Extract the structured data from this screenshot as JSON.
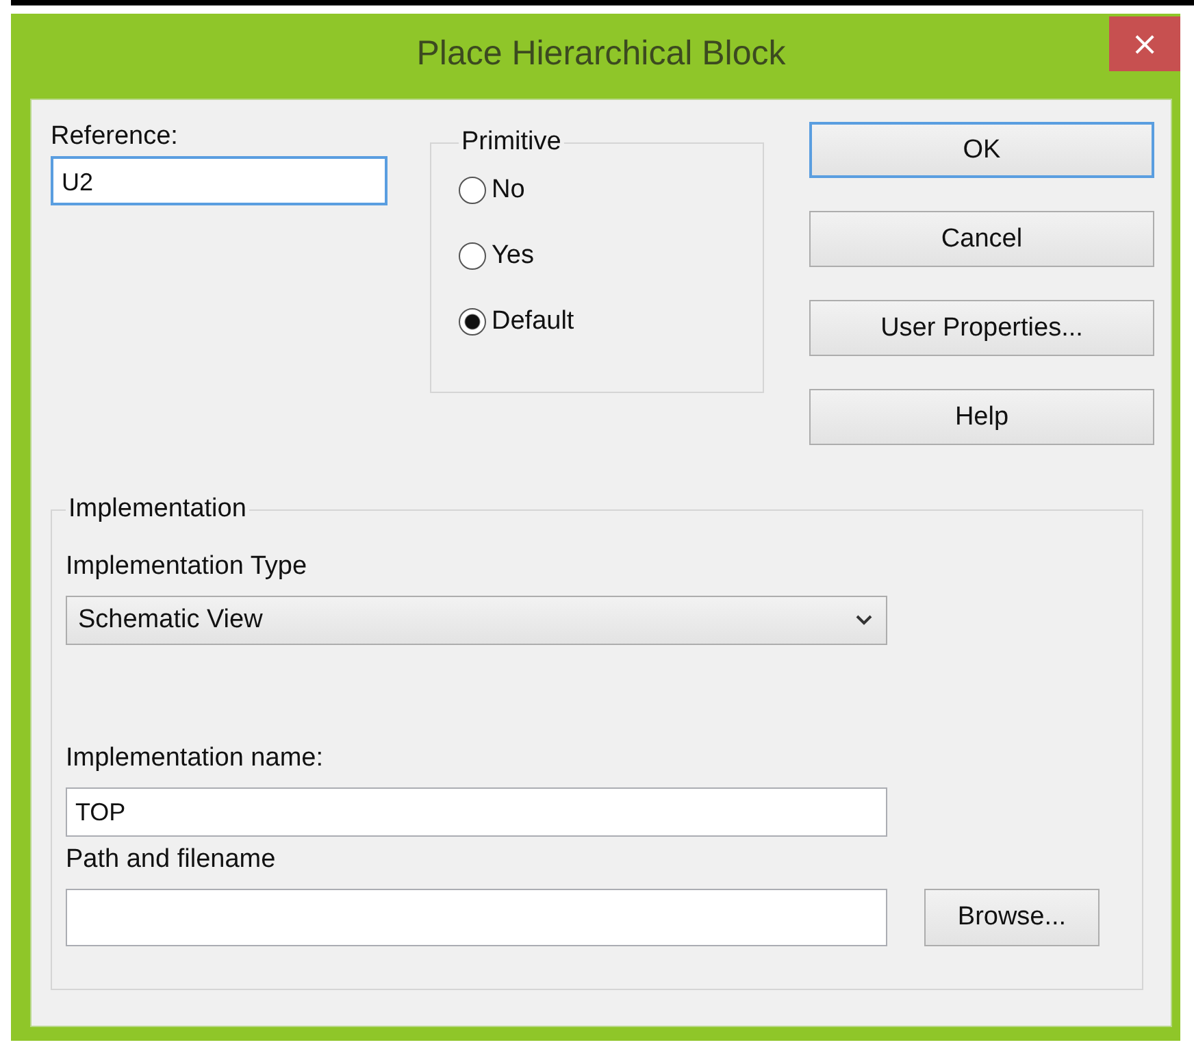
{
  "window": {
    "title": "Place Hierarchical Block",
    "close": "×"
  },
  "reference": {
    "label": "Reference:",
    "value": "U2",
    "focused": true
  },
  "primitive": {
    "title": "Primitive",
    "options": [
      {
        "label": "No",
        "selected": false
      },
      {
        "label": "Yes",
        "selected": false
      },
      {
        "label": "Default",
        "selected": true
      }
    ]
  },
  "buttons": [
    {
      "label": "OK",
      "default": true
    },
    {
      "label": "Cancel",
      "default": false
    },
    {
      "label": "User Properties...",
      "default": false
    },
    {
      "label": "Help",
      "default": false
    }
  ],
  "implementation": {
    "title": "Implementation",
    "type": {
      "label": "Implementation Type",
      "value": "Schematic View"
    },
    "name": {
      "label": "Implementation name:",
      "value": "TOP"
    },
    "path": {
      "label": "Path and filename"
    },
    "browse": "Browse..."
  }
}
